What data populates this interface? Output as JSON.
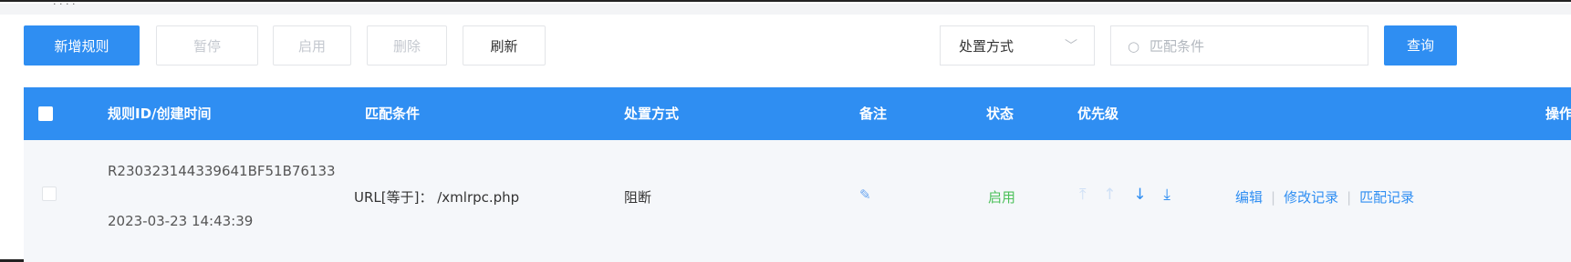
{
  "toolbar": {
    "add_rule": "新增规则",
    "pause": "暂停",
    "enable": "启用",
    "delete": "删除",
    "refresh": "刷新",
    "action_select": "处置方式",
    "search_placeholder": "匹配条件",
    "query": "查询"
  },
  "table": {
    "headers": {
      "rule_id": "规则ID/创建时间",
      "match": "匹配条件",
      "action": "处置方式",
      "remark": "备注",
      "status": "状态",
      "priority": "优先级",
      "operation": "操作"
    },
    "rows": [
      {
        "rule_id": "R230323144339641BF51B76133",
        "created": "2023-03-23 14:43:39",
        "match": "URL[等于]：  /xmlrpc.php",
        "action": "阻断",
        "status": "启用",
        "ops": {
          "edit": "编辑",
          "modify_log": "修改记录",
          "match_log": "匹配记录"
        }
      }
    ]
  },
  "colors": {
    "primary": "#2f8ef2",
    "status_green": "#4cc05a",
    "row_bg": "#f5f7fa"
  },
  "icons": {
    "remark": "pencil-icon",
    "priority": [
      "top-icon",
      "up-icon",
      "down-icon",
      "bottom-icon"
    ],
    "search": "search-icon",
    "select": "chevron-down-icon"
  }
}
